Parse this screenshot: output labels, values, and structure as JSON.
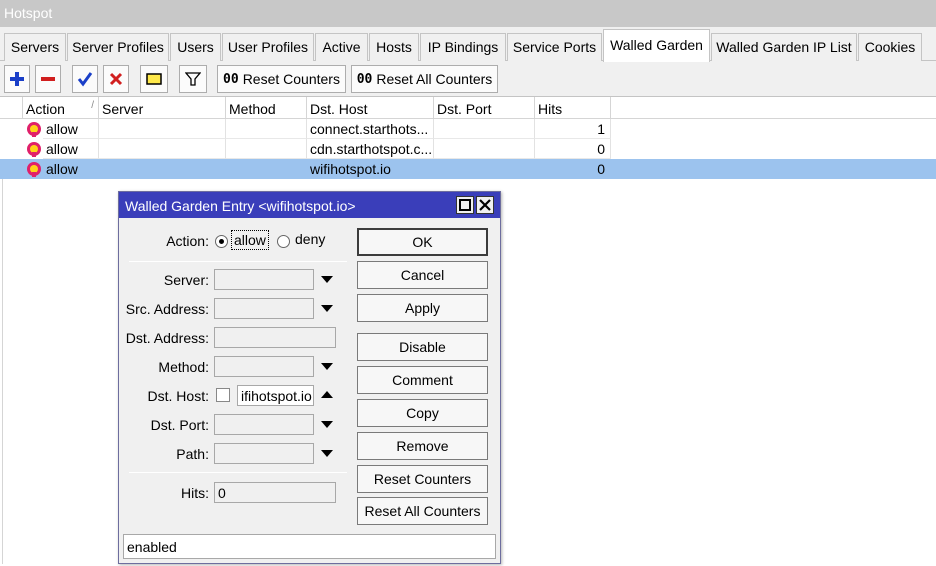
{
  "window": {
    "title": "Hotspot"
  },
  "tabs": [
    {
      "label": "Servers"
    },
    {
      "label": "Server Profiles"
    },
    {
      "label": "Users"
    },
    {
      "label": "User Profiles"
    },
    {
      "label": "Active"
    },
    {
      "label": "Hosts"
    },
    {
      "label": "IP Bindings"
    },
    {
      "label": "Service Ports"
    },
    {
      "label": "Walled Garden"
    },
    {
      "label": "Walled Garden IP List"
    },
    {
      "label": "Cookies"
    }
  ],
  "active_tab": "Walled Garden",
  "toolbar": {
    "reset_counters_label": "Reset Counters",
    "reset_all_counters_label": "Reset All Counters",
    "counter_prefix": "00"
  },
  "table": {
    "columns": [
      "Action",
      "Server",
      "Method",
      "Dst. Host",
      "Dst. Port",
      "Hits"
    ],
    "rows": [
      {
        "action": "allow",
        "server": "",
        "method": "",
        "dst_host": "connect.starthots...",
        "dst_port": "",
        "hits": "1"
      },
      {
        "action": "allow",
        "server": "",
        "method": "",
        "dst_host": "cdn.starthotspot.c...",
        "dst_port": "",
        "hits": "0"
      },
      {
        "action": "allow",
        "server": "",
        "method": "",
        "dst_host": "wifihotspot.io",
        "dst_port": "",
        "hits": "0",
        "selected": true
      }
    ]
  },
  "dialog": {
    "title": "Walled Garden Entry <wifihotspot.io>",
    "action_label": "Action:",
    "action_options": [
      "allow",
      "deny"
    ],
    "action_selected": "allow",
    "fields": {
      "server_label": "Server:",
      "src_address_label": "Src. Address:",
      "dst_address_label": "Dst. Address:",
      "method_label": "Method:",
      "dst_host_label": "Dst. Host:",
      "dst_host_value": "ifihotspot.io",
      "dst_port_label": "Dst. Port:",
      "path_label": "Path:",
      "hits_label": "Hits:",
      "hits_value": "0"
    },
    "buttons": {
      "ok": "OK",
      "cancel": "Cancel",
      "apply": "Apply",
      "disable": "Disable",
      "comment": "Comment",
      "copy": "Copy",
      "remove": "Remove",
      "reset_counters": "Reset Counters",
      "reset_all_counters": "Reset All Counters"
    },
    "status": "enabled"
  },
  "colors": {
    "dialog_title_bg": "#3a3eba",
    "selected_row_bg": "#9cc3ee",
    "add_icon": "#1a3fc8",
    "remove_icon": "#d11f1f"
  },
  "icons": [
    "add-icon",
    "remove-icon",
    "enable-check-icon",
    "disable-x-icon",
    "comment-icon",
    "filter-icon",
    "hotspot-allow-icon"
  ]
}
